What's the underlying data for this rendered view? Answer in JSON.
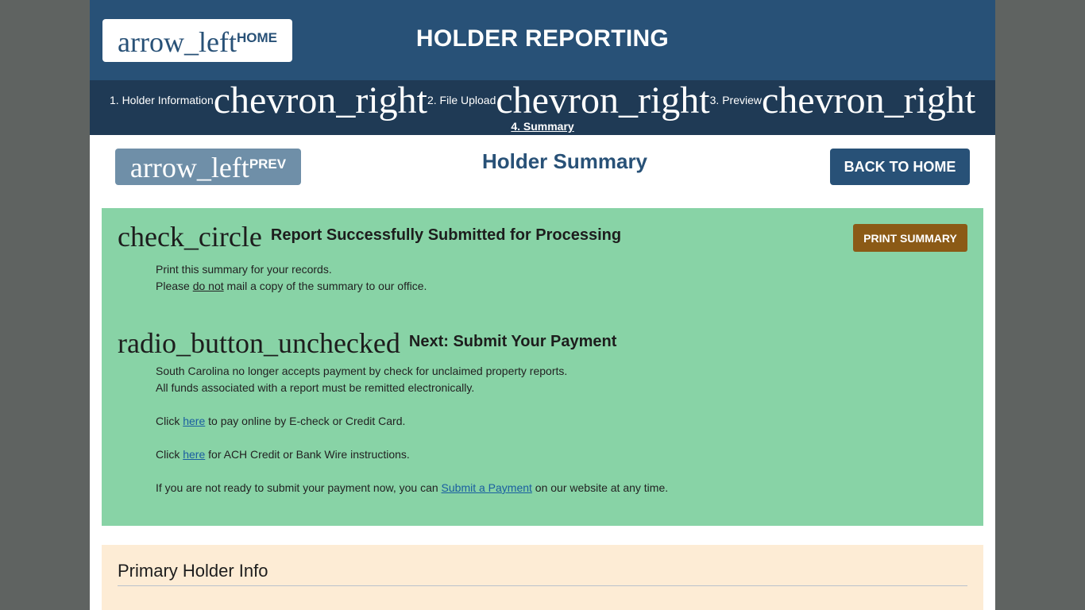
{
  "header": {
    "home_icon": "arrow_left",
    "home_label": "HOME",
    "title": "HOLDER REPORTING"
  },
  "steps": {
    "chevron_icon": "chevron_right",
    "items": [
      {
        "label": "1. Holder Information"
      },
      {
        "label": "2. File Upload"
      },
      {
        "label": "3. Preview"
      }
    ],
    "current": "4. Summary"
  },
  "subnav": {
    "prev_icon": "arrow_left",
    "prev_label": "PREV",
    "page_title": "Holder Summary",
    "back_label": "BACK TO HOME"
  },
  "success": {
    "icon": "check_circle",
    "heading": "Report Successfully Submitted for Processing",
    "print_label": "PRINT SUMMARY",
    "line1": "Print this summary for your records.",
    "line2_pre": "Please ",
    "line2_emph": "do not",
    "line2_post": " mail a copy of the summary to our office."
  },
  "payment": {
    "icon": "radio_button_unchecked",
    "heading": "Next: Submit Your Payment",
    "line1": "South Carolina no longer accepts payment by check for unclaimed property reports.",
    "line2": "All funds associated with a report must be remitted electronically.",
    "online_pre": "Click ",
    "online_link": "here",
    "online_post": " to pay online by E-check or Credit Card.",
    "ach_pre": "Click ",
    "ach_link": "here",
    "ach_post": " for ACH Credit or Bank Wire instructions.",
    "later_pre": "If you are not ready to submit your payment now, you can ",
    "later_link": "Submit a Payment",
    "later_post": " on our website at any time."
  },
  "holder_info": {
    "title": "Primary Holder Info"
  },
  "colors": {
    "header_blue": "#285177",
    "steps_bar": "#1f3a55",
    "success_green": "#88d3a6",
    "print_button": "#8b5a16",
    "info_panel": "#fdecd5"
  }
}
